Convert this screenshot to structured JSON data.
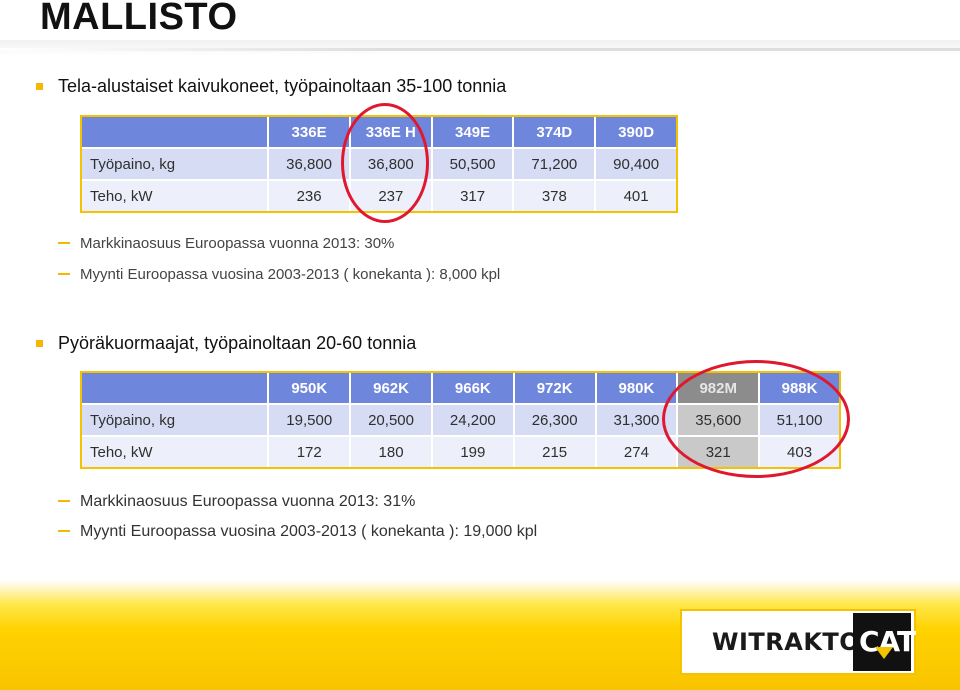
{
  "title": "MALLISTO",
  "section1": {
    "heading": "Tela-alustaiset kaivukoneet, työpainoltaan 35-100 tonnia",
    "table": {
      "header": [
        "",
        "336E",
        "336E H",
        "349E",
        "374D",
        "390D"
      ],
      "rows": [
        {
          "label": "Työpaino, kg",
          "values": [
            "36,800",
            "36,800",
            "50,500",
            "71,200",
            "90,400"
          ]
        },
        {
          "label": "Teho, kW",
          "values": [
            "236",
            "237",
            "317",
            "378",
            "401"
          ]
        }
      ]
    },
    "notes": [
      "Markkinaosuus Euroopassa vuonna 2013: 30%",
      "Myynti Euroopassa vuosina 2003-2013 ( konekanta ): 8,000 kpl"
    ]
  },
  "section2": {
    "heading": "Pyöräkuormaajat, työpainoltaan 20-60 tonnia",
    "table": {
      "header": [
        "",
        "950K",
        "962K",
        "966K",
        "972K",
        "980K",
        "982M",
        "988K"
      ],
      "rows": [
        {
          "label": "Työpaino, kg",
          "values": [
            "19,500",
            "20,500",
            "24,200",
            "26,300",
            "31,300",
            "35,600",
            "51,100"
          ]
        },
        {
          "label": "Teho, kW",
          "values": [
            "172",
            "180",
            "199",
            "215",
            "274",
            "321",
            "403"
          ]
        }
      ]
    },
    "notes": [
      "Markkinaosuus Euroopassa vuonna 2013: 31%",
      "Myynti Euroopassa vuosina 2003-2013 ( konekanta ): 19,000 kpl"
    ]
  },
  "logo": {
    "company": "WITRAKTOR",
    "brand": "CAT"
  },
  "colors": {
    "accent_yellow": "#f3b800",
    "header_blue": "#6f86dd",
    "highlight_red": "#e0182f"
  }
}
